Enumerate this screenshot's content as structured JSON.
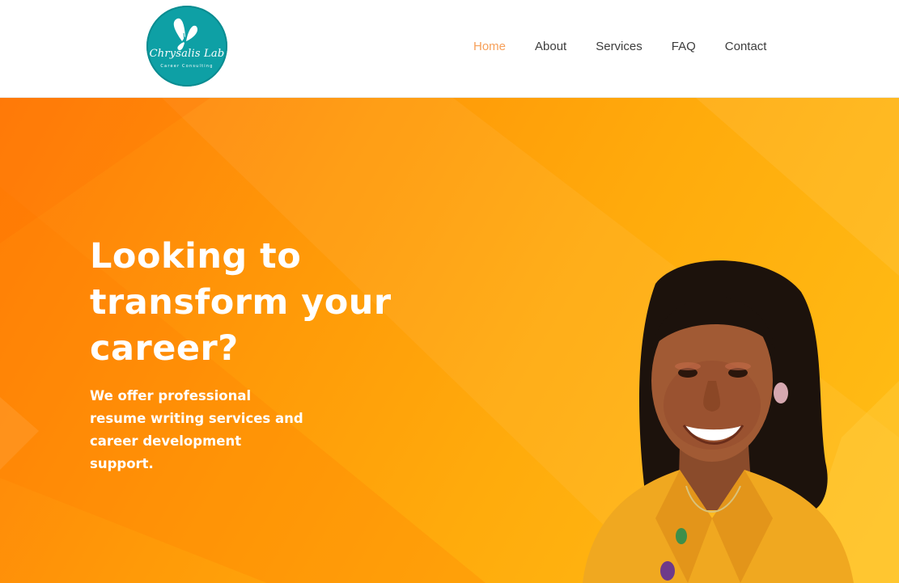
{
  "brand": {
    "logo_script": "Chrysalis Lab",
    "logo_tagline": "Career Consulting",
    "logo_color": "#0ea0a5"
  },
  "nav": {
    "items": [
      {
        "label": "Home",
        "active": true
      },
      {
        "label": "About",
        "active": false
      },
      {
        "label": "Services",
        "active": false
      },
      {
        "label": "FAQ",
        "active": false
      },
      {
        "label": "Contact",
        "active": false
      }
    ],
    "active_color": "#f6a05a"
  },
  "hero": {
    "headline_lines": [
      "Looking to",
      "transform your",
      "career?"
    ],
    "subtext": "We offer professional resume writing services and career development support.",
    "gradient_colors": [
      "#ff7d0a",
      "#ffbf16"
    ]
  }
}
